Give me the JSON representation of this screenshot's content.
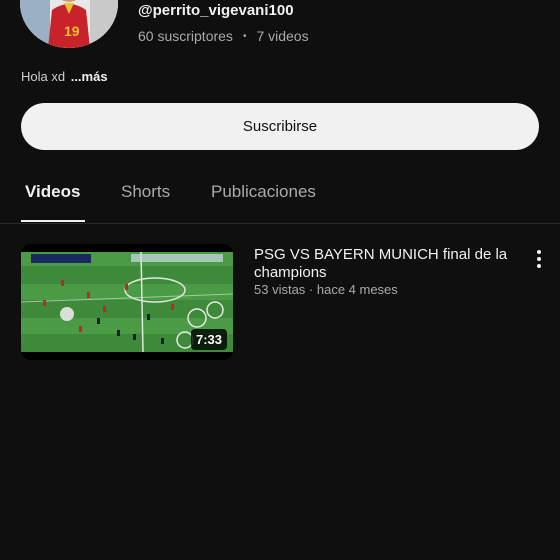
{
  "channel": {
    "handle": "@perrito_vigevani100",
    "subscribers": "60 suscriptores",
    "separator": "•",
    "videos": "7 videos",
    "description": "Hola xd",
    "more_label": "...más",
    "avatar_jersey_number": "19"
  },
  "subscribe_label": "Suscribirse",
  "tabs": [
    {
      "label": "Videos",
      "active": true
    },
    {
      "label": "Shorts",
      "active": false
    },
    {
      "label": "Publicaciones",
      "active": false
    }
  ],
  "video": {
    "title": "PSG VS BAYERN MUNICH final de la champions",
    "meta": "53 vistas · hace 4 meses",
    "duration": "7:33",
    "menu_icon": "more-vert-icon"
  },
  "colors": {
    "background": "#0f0f0f",
    "text_primary": "#f1f1f1",
    "text_secondary": "#aaaaaa",
    "subscribe_bg": "#f1f1f1",
    "pitch_green": "#3f8a3a"
  }
}
